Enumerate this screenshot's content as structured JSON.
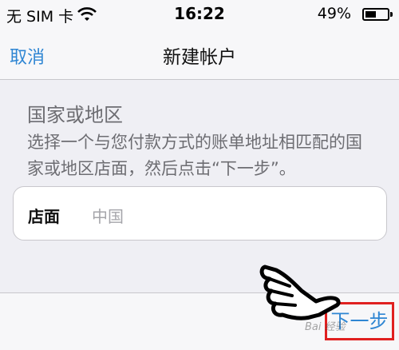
{
  "status": {
    "carrier": "无 SIM 卡",
    "time": "16:22",
    "battery_percent": "49%",
    "battery_level": 0.49
  },
  "nav": {
    "cancel_label": "取消",
    "title": "新建帐户"
  },
  "section": {
    "title": "国家或地区",
    "description": "选择一个与您付款方式的账单地址相匹配的国家或地区店面，然后点击“下一步”。"
  },
  "store": {
    "label": "店面",
    "value": "中国"
  },
  "toolbar": {
    "next_label": "下一步"
  },
  "overlay": {
    "highlight_color": "#e02020",
    "pointer_icon": "hand-pointer-icon",
    "watermark_text": "Bai 经验"
  },
  "colors": {
    "accent": "#2f86d3",
    "background": "#efeff4"
  }
}
